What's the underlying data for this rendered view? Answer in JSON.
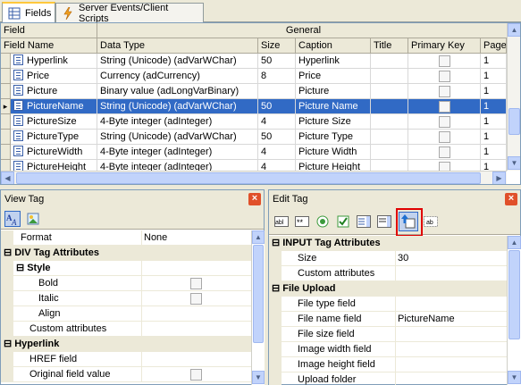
{
  "tabs": [
    {
      "label": "Fields",
      "icon": "table-icon",
      "active": true
    },
    {
      "label": "Server Events/Client Scripts",
      "icon": "lightning-icon",
      "active": false
    }
  ],
  "grid": {
    "corner_label": "Field",
    "group_label": "General",
    "columns": [
      "Field Name",
      "Data Type",
      "Size",
      "Caption",
      "Title",
      "Primary Key",
      "Page"
    ],
    "rows": [
      {
        "name": "Hyperlink",
        "type": "String (Unicode) (adVarWChar)",
        "size": "50",
        "caption": "Hyperlink",
        "title": "",
        "page": "1"
      },
      {
        "name": "Price",
        "type": "Currency (adCurrency)",
        "size": "8",
        "caption": "Price",
        "title": "",
        "page": "1"
      },
      {
        "name": "Picture",
        "type": "Binary value (adLongVarBinary)",
        "size": "",
        "caption": "Picture",
        "title": "",
        "page": "1"
      },
      {
        "name": "PictureName",
        "type": "String (Unicode) (adVarWChar)",
        "size": "50",
        "caption": "Picture Name",
        "title": "",
        "page": "1",
        "selected": true
      },
      {
        "name": "PictureSize",
        "type": "4-Byte integer (adInteger)",
        "size": "4",
        "caption": "Picture Size",
        "title": "",
        "page": "1"
      },
      {
        "name": "PictureType",
        "type": "String (Unicode) (adVarWChar)",
        "size": "50",
        "caption": "Picture Type",
        "title": "",
        "page": "1"
      },
      {
        "name": "PictureWidth",
        "type": "4-Byte integer (adInteger)",
        "size": "4",
        "caption": "Picture Width",
        "title": "",
        "page": "1"
      },
      {
        "name": "PictureHeight",
        "type": "4-Byte integer (adInteger)",
        "size": "4",
        "caption": "Picture Height",
        "title": "",
        "page": "1"
      }
    ]
  },
  "view_tag": {
    "title": "View Tag",
    "toolbar": [
      "alphabetical-sort-icon",
      "image-icon"
    ],
    "rows": [
      {
        "kind": "prop",
        "name": "Format",
        "value": "None",
        "indent": 1
      },
      {
        "kind": "cat",
        "name": "DIV Tag Attributes",
        "sym": "⊟"
      },
      {
        "kind": "subcat",
        "name": "Style",
        "sym": "⊟"
      },
      {
        "kind": "prop",
        "name": "Bold",
        "value": "",
        "check": true,
        "indent": 3
      },
      {
        "kind": "prop",
        "name": "Italic",
        "value": "",
        "check": true,
        "indent": 3
      },
      {
        "kind": "prop",
        "name": "Align",
        "value": "",
        "indent": 3
      },
      {
        "kind": "prop",
        "name": "Custom attributes",
        "value": "",
        "indent": 2
      },
      {
        "kind": "cat",
        "name": "Hyperlink",
        "sym": "⊟"
      },
      {
        "kind": "prop",
        "name": "HREF field",
        "value": "",
        "indent": 2
      },
      {
        "kind": "prop",
        "name": "Original field value",
        "value": "",
        "check": true,
        "indent": 2
      }
    ]
  },
  "edit_tag": {
    "title": "Edit Tag",
    "toolbar": [
      "text-field-icon",
      "password-field-icon",
      "radio-button-icon",
      "checkbox-icon",
      "select-list-icon",
      "textarea-icon",
      "file-upload-icon",
      "hidden-field-icon"
    ],
    "rows": [
      {
        "kind": "cat",
        "name": "INPUT Tag Attributes",
        "sym": "⊟"
      },
      {
        "kind": "prop",
        "name": "Size",
        "value": "30"
      },
      {
        "kind": "prop",
        "name": "Custom attributes",
        "value": ""
      },
      {
        "kind": "cat",
        "name": "File Upload",
        "sym": "⊟"
      },
      {
        "kind": "prop",
        "name": "File type field",
        "value": ""
      },
      {
        "kind": "prop",
        "name": "File name field",
        "value": "PictureName"
      },
      {
        "kind": "prop",
        "name": "File size field",
        "value": ""
      },
      {
        "kind": "prop",
        "name": "Image width field",
        "value": ""
      },
      {
        "kind": "prop",
        "name": "Image height field",
        "value": ""
      },
      {
        "kind": "prop",
        "name": "Upload folder",
        "value": ""
      }
    ]
  },
  "colors": {
    "selection": "#316ac5",
    "highlight_box": "#e00000",
    "close_button": "#e0502a"
  }
}
